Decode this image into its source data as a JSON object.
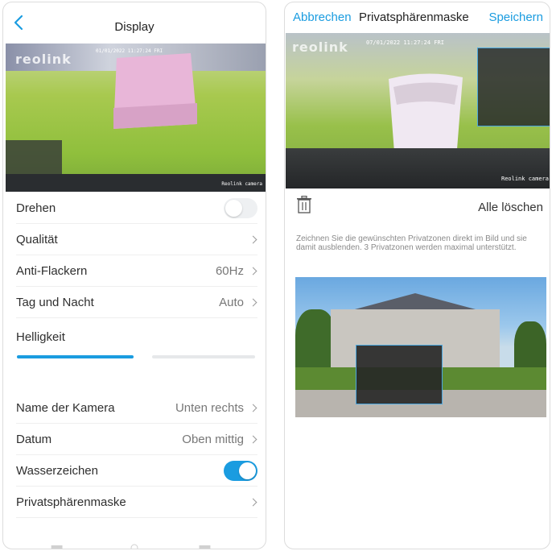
{
  "left": {
    "header": {
      "title": "Display"
    },
    "camera": {
      "watermark": "reolink",
      "osd_date": "01/01/2022 11:27:24 FRI",
      "osd_name": "Reolink camera"
    },
    "rows": [
      {
        "label": "Drehen",
        "type": "toggle",
        "on": false
      },
      {
        "label": "Qualität",
        "type": "nav",
        "value": ""
      },
      {
        "label": "Anti-Flackern",
        "type": "nav",
        "value": "60Hz"
      },
      {
        "label": "Tag und Nacht",
        "type": "nav",
        "value": "Auto"
      }
    ],
    "brightness": {
      "label": "Helligkeit",
      "level": 0.5
    },
    "rows2": [
      {
        "label": "Name der Kamera",
        "type": "nav",
        "value": "Unten rechts"
      },
      {
        "label": "Datum",
        "type": "nav",
        "value": "Oben mittig"
      },
      {
        "label": "Wasserzeichen",
        "type": "toggle",
        "on": true
      },
      {
        "label": "Privatsphärenmaske",
        "type": "nav",
        "value": ""
      }
    ],
    "colors": {
      "accent": "#1a9ce0"
    }
  },
  "right": {
    "header": {
      "cancel": "Abbrechen",
      "title": "Privatsphärenmaske",
      "save": "Speichern"
    },
    "camera": {
      "watermark": "reolink",
      "osd_date": "07/01/2022 11:27:24 FRI",
      "osd_name": "Reolink camera"
    },
    "clear_all": "Alle löschen",
    "hint": "Zeichnen Sie die gewünschten Privatzonen direkt im Bild und sie damit ausblenden. 3 Privatzonen werden maximal unterstützt."
  }
}
